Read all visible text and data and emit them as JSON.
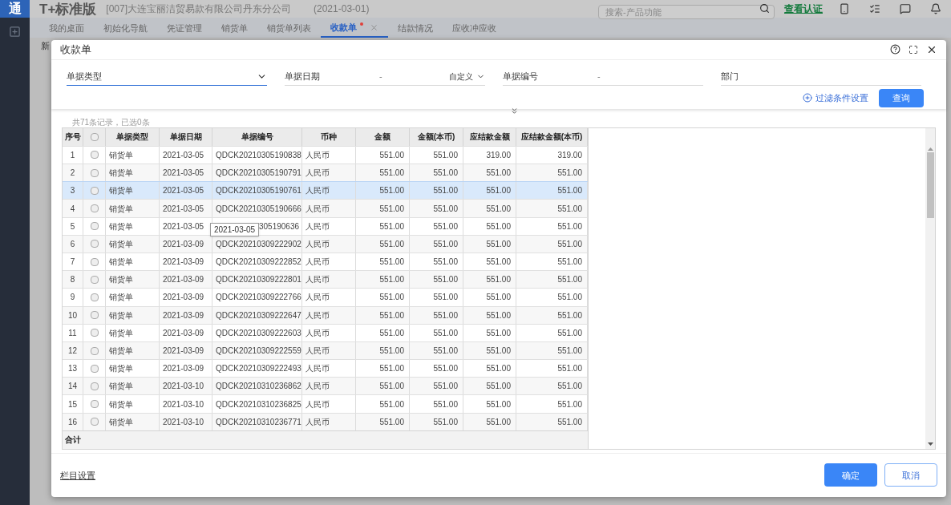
{
  "app": {
    "logo_mark": "通",
    "product": "T+标准版",
    "company": "[007]大连宝丽洁贸易款有限公司丹东分公司",
    "date": "(2021-03-01)",
    "search": {
      "placeholder": "搜索-产品功能"
    },
    "cert_link": "查看认证",
    "toolbar_fragment": "新"
  },
  "tabs": [
    {
      "label": "我的桌面",
      "selected": false,
      "dirty": false
    },
    {
      "label": "初始化导航",
      "selected": false,
      "dirty": false
    },
    {
      "label": "凭证管理",
      "selected": false,
      "dirty": false
    },
    {
      "label": "销货单",
      "selected": false,
      "dirty": false
    },
    {
      "label": "销货单列表",
      "selected": false,
      "dirty": false
    },
    {
      "label": "收款单",
      "selected": true,
      "dirty": true
    },
    {
      "label": "结款情况",
      "selected": false,
      "dirty": false
    },
    {
      "label": "应收冲应收",
      "selected": false,
      "dirty": false
    }
  ],
  "dialog": {
    "title": "收款单",
    "filters": [
      {
        "kind": "select",
        "label": "单据类型",
        "focused": true
      },
      {
        "kind": "range",
        "label": "单据日期",
        "separator": "-",
        "option": "自定义",
        "focused": false
      },
      {
        "kind": "range",
        "label": "单据编号",
        "separator": "-",
        "focused": false
      },
      {
        "kind": "text",
        "label": "部门",
        "focused": false
      }
    ],
    "filter_settings_link": "过滤条件设置",
    "query_button": "查询",
    "record_count": "共71条记录，已选0条",
    "table": {
      "columns": [
        "序号",
        "",
        "单据类型",
        "单据日期",
        "单据编号",
        "币种",
        "金额",
        "金额(本币)",
        "应结款金额",
        "应结款金额(本币)"
      ],
      "rows": [
        {
          "no": "1",
          "checked": false,
          "selected": false,
          "type": "销货单",
          "date": "2021-03-05",
          "number": "QDCK20210305190838",
          "currency": "人民币",
          "amount": "551.00",
          "amount_local": "551.00",
          "due": "319.00",
          "due_local": "319.00"
        },
        {
          "no": "2",
          "checked": false,
          "selected": false,
          "type": "销货单",
          "date": "2021-03-05",
          "number": "QDCK20210305190791",
          "currency": "人民币",
          "amount": "551.00",
          "amount_local": "551.00",
          "due": "551.00",
          "due_local": "551.00"
        },
        {
          "no": "3",
          "checked": false,
          "selected": true,
          "type": "销货单",
          "date": "2021-03-05",
          "number": "QDCK20210305190761",
          "currency": "人民币",
          "amount": "551.00",
          "amount_local": "551.00",
          "due": "551.00",
          "due_local": "551.00"
        },
        {
          "no": "4",
          "checked": false,
          "selected": false,
          "type": "销货单",
          "date": "2021-03-05",
          "number": "QDCK20210305190666",
          "currency": "人民币",
          "amount": "551.00",
          "amount_local": "551.00",
          "due": "551.00",
          "due_local": "551.00"
        },
        {
          "no": "5",
          "checked": false,
          "selected": false,
          "type": "销货单",
          "date": "2021-03-05",
          "number": "305190636",
          "tooltip": "2021-03-05",
          "currency": "人民币",
          "amount": "551.00",
          "amount_local": "551.00",
          "due": "551.00",
          "due_local": "551.00"
        },
        {
          "no": "6",
          "checked": false,
          "selected": false,
          "type": "销货单",
          "date": "2021-03-09",
          "number": "QDCK20210309222902",
          "currency": "人民币",
          "amount": "551.00",
          "amount_local": "551.00",
          "due": "551.00",
          "due_local": "551.00"
        },
        {
          "no": "7",
          "checked": false,
          "selected": false,
          "type": "销货单",
          "date": "2021-03-09",
          "number": "QDCK20210309222852",
          "currency": "人民币",
          "amount": "551.00",
          "amount_local": "551.00",
          "due": "551.00",
          "due_local": "551.00"
        },
        {
          "no": "8",
          "checked": false,
          "selected": false,
          "type": "销货单",
          "date": "2021-03-09",
          "number": "QDCK20210309222801",
          "currency": "人民币",
          "amount": "551.00",
          "amount_local": "551.00",
          "due": "551.00",
          "due_local": "551.00"
        },
        {
          "no": "9",
          "checked": false,
          "selected": false,
          "type": "销货单",
          "date": "2021-03-09",
          "number": "QDCK20210309222766",
          "currency": "人民币",
          "amount": "551.00",
          "amount_local": "551.00",
          "due": "551.00",
          "due_local": "551.00"
        },
        {
          "no": "10",
          "checked": false,
          "selected": false,
          "type": "销货单",
          "date": "2021-03-09",
          "number": "QDCK20210309222647",
          "currency": "人民币",
          "amount": "551.00",
          "amount_local": "551.00",
          "due": "551.00",
          "due_local": "551.00"
        },
        {
          "no": "11",
          "checked": false,
          "selected": false,
          "type": "销货单",
          "date": "2021-03-09",
          "number": "QDCK20210309222603",
          "currency": "人民币",
          "amount": "551.00",
          "amount_local": "551.00",
          "due": "551.00",
          "due_local": "551.00"
        },
        {
          "no": "12",
          "checked": false,
          "selected": false,
          "type": "销货单",
          "date": "2021-03-09",
          "number": "QDCK20210309222559",
          "currency": "人民币",
          "amount": "551.00",
          "amount_local": "551.00",
          "due": "551.00",
          "due_local": "551.00"
        },
        {
          "no": "13",
          "checked": false,
          "selected": false,
          "type": "销货单",
          "date": "2021-03-09",
          "number": "QDCK20210309222493",
          "currency": "人民币",
          "amount": "551.00",
          "amount_local": "551.00",
          "due": "551.00",
          "due_local": "551.00"
        },
        {
          "no": "14",
          "checked": false,
          "selected": false,
          "type": "销货单",
          "date": "2021-03-10",
          "number": "QDCK20210310236862",
          "currency": "人民币",
          "amount": "551.00",
          "amount_local": "551.00",
          "due": "551.00",
          "due_local": "551.00"
        },
        {
          "no": "15",
          "checked": false,
          "selected": false,
          "type": "销货单",
          "date": "2021-03-10",
          "number": "QDCK20210310236825",
          "currency": "人民币",
          "amount": "551.00",
          "amount_local": "551.00",
          "due": "551.00",
          "due_local": "551.00"
        },
        {
          "no": "16",
          "checked": false,
          "selected": false,
          "type": "销货单",
          "date": "2021-03-10",
          "number": "QDCK20210310236771",
          "currency": "人民币",
          "amount": "551.00",
          "amount_local": "551.00",
          "due": "551.00",
          "due_local": "551.00"
        }
      ],
      "total_label": "合计",
      "all_checked": false
    },
    "column_settings_link": "栏目设置",
    "ok_button": "确定",
    "cancel_button": "取消"
  }
}
